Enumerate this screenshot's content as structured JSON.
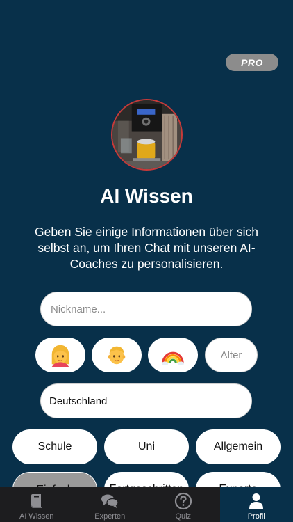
{
  "badge": {
    "label": "PRO"
  },
  "header": {
    "title": "AI Wissen",
    "description": "Geben Sie einige Informationen über sich selbst an, um Ihren Chat mit unseren AI-Coaches zu personalisieren."
  },
  "form": {
    "nickname_placeholder": "Nickname...",
    "age_placeholder": "Alter",
    "country_value": "Deutschland",
    "gender_options": [
      "woman-emoji",
      "boy-emoji",
      "rainbow-emoji"
    ]
  },
  "categories": [
    "Schule",
    "Uni",
    "Allgemein"
  ],
  "levels": [
    "Einfach",
    "Fortgeschritten",
    "Experte"
  ],
  "tabs": [
    {
      "label": "AI Wissen",
      "icon": "book-icon"
    },
    {
      "label": "Experten",
      "icon": "chat-bubbles-icon"
    },
    {
      "label": "Quiz",
      "icon": "question-circle-icon"
    },
    {
      "label": "Profil",
      "icon": "person-icon",
      "active": true
    }
  ]
}
